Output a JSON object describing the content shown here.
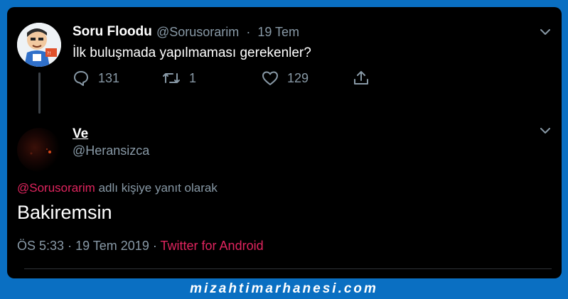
{
  "parent_tweet": {
    "display_name": "Soru Floodu",
    "handle": "@Sorusorarim",
    "separator": "·",
    "date": "19 Tem",
    "text": "İlk buluşmada yapılmaması gerekenler?",
    "actions": {
      "reply_count": "131",
      "retweet_count": "1",
      "like_count": "129"
    }
  },
  "reply_tweet": {
    "display_name": "Ve",
    "handle": "@Heransizca",
    "reply_to_mention": "@Sorusorarim",
    "reply_to_suffix": "adlı kişiye yanıt olarak",
    "text": "Bakiremsin",
    "time": "ÖS 5:33",
    "separator1": "·",
    "date": "19 Tem 2019",
    "separator2": "·",
    "source": "Twitter for Android"
  },
  "watermark": "mizahtimarhanesi.com",
  "colors": {
    "background": "#000000",
    "frame": "#0a6fc2",
    "secondary_text": "#8899a6",
    "accent": "#e0245e"
  },
  "icons": [
    "avatar",
    "chevron-down-icon",
    "reply-icon",
    "retweet-icon",
    "like-icon",
    "share-icon"
  ]
}
